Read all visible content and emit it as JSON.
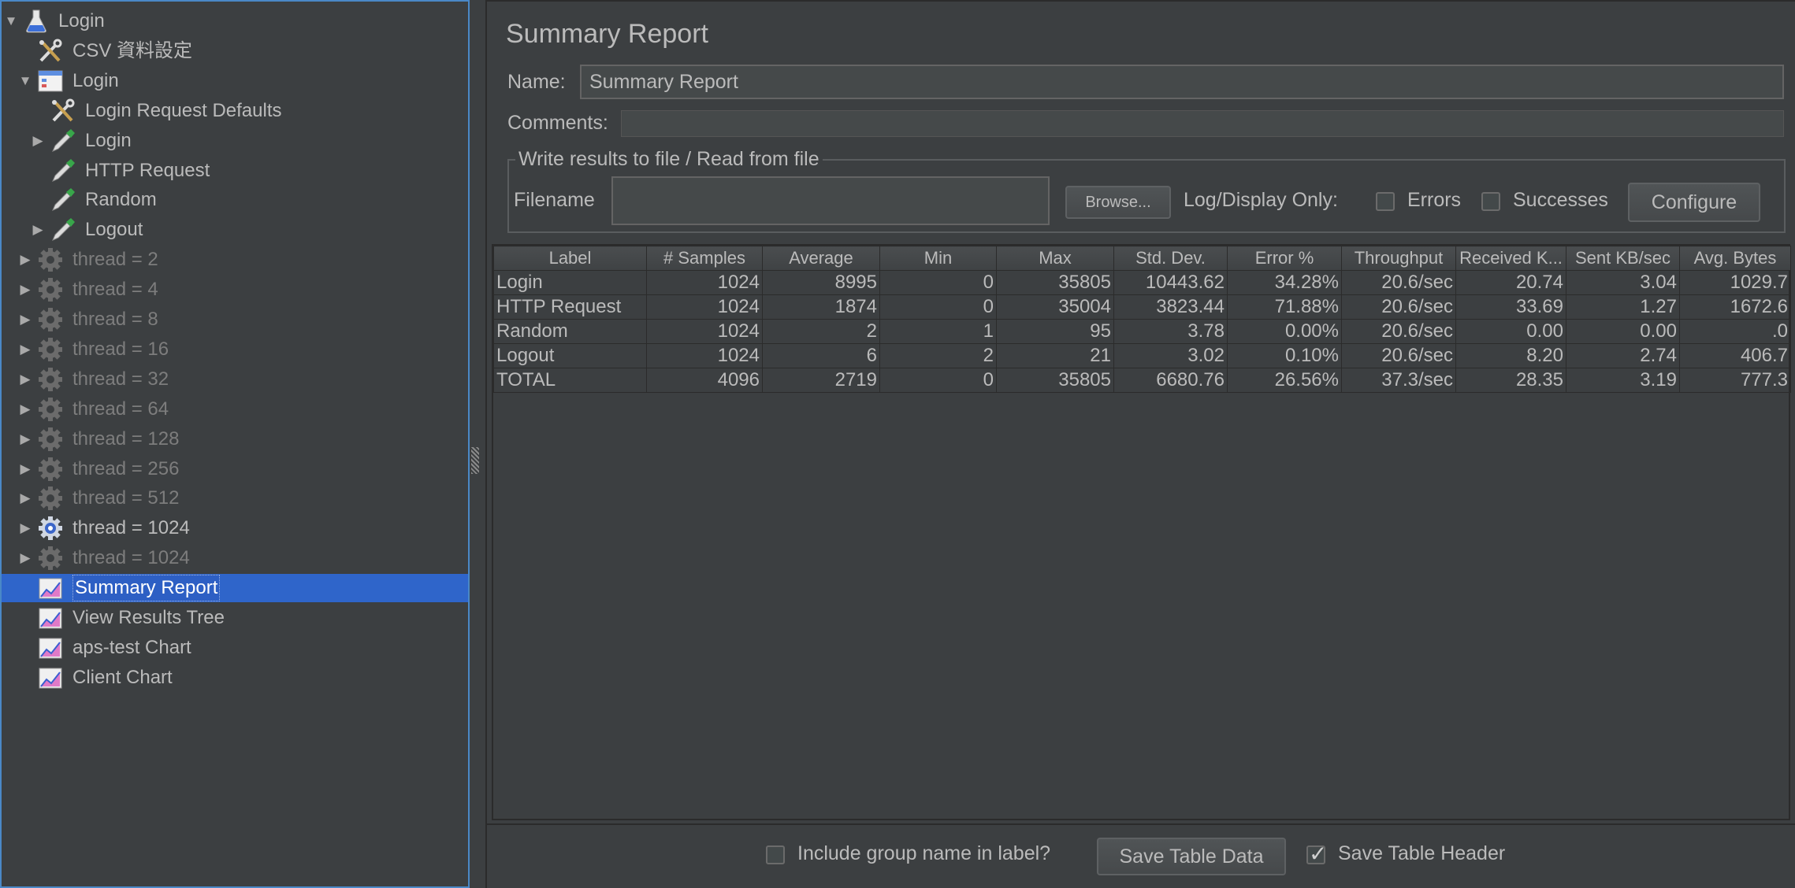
{
  "tree": [
    {
      "label": "Login",
      "icon": "flask-icon",
      "arrow": "▼",
      "level": 0,
      "state": "normal"
    },
    {
      "label": "CSV 資料設定",
      "icon": "config-tools-icon",
      "arrow": "",
      "level": 1,
      "state": "normal"
    },
    {
      "label": "Login",
      "icon": "thread-group-icon",
      "arrow": "▼",
      "level": 1,
      "state": "normal"
    },
    {
      "label": "Login Request Defaults",
      "icon": "config-tools-icon",
      "arrow": "",
      "level": 2,
      "state": "normal"
    },
    {
      "label": "Login",
      "icon": "sampler-pipette-icon",
      "arrow": "▶",
      "level": 2,
      "state": "normal"
    },
    {
      "label": "HTTP Request",
      "icon": "sampler-pipette-icon",
      "arrow": "",
      "level": 2,
      "state": "normal"
    },
    {
      "label": "Random",
      "icon": "sampler-pipette-icon",
      "arrow": "",
      "level": 2,
      "state": "normal"
    },
    {
      "label": "Logout",
      "icon": "sampler-pipette-icon",
      "arrow": "▶",
      "level": 2,
      "state": "normal"
    },
    {
      "label": "thread = 2",
      "icon": "gear-icon",
      "arrow": "▶",
      "level": 1,
      "state": "disabled"
    },
    {
      "label": "thread = 4",
      "icon": "gear-icon",
      "arrow": "▶",
      "level": 1,
      "state": "disabled"
    },
    {
      "label": "thread = 8",
      "icon": "gear-icon",
      "arrow": "▶",
      "level": 1,
      "state": "disabled"
    },
    {
      "label": "thread = 16",
      "icon": "gear-icon",
      "arrow": "▶",
      "level": 1,
      "state": "disabled"
    },
    {
      "label": "thread = 32",
      "icon": "gear-icon",
      "arrow": "▶",
      "level": 1,
      "state": "disabled"
    },
    {
      "label": "thread = 64",
      "icon": "gear-icon",
      "arrow": "▶",
      "level": 1,
      "state": "disabled"
    },
    {
      "label": "thread = 128",
      "icon": "gear-icon",
      "arrow": "▶",
      "level": 1,
      "state": "disabled"
    },
    {
      "label": "thread = 256",
      "icon": "gear-icon",
      "arrow": "▶",
      "level": 1,
      "state": "disabled"
    },
    {
      "label": "thread = 512",
      "icon": "gear-icon",
      "arrow": "▶",
      "level": 1,
      "state": "disabled"
    },
    {
      "label": "thread = 1024",
      "icon": "gear-active-icon",
      "arrow": "▶",
      "level": 1,
      "state": "normal"
    },
    {
      "label": "thread = 1024",
      "icon": "gear-icon",
      "arrow": "▶",
      "level": 1,
      "state": "disabled"
    },
    {
      "label": "Summary Report",
      "icon": "chart-listener-icon",
      "arrow": "",
      "level": 1,
      "state": "selected"
    },
    {
      "label": "View Results Tree",
      "icon": "chart-listener-icon",
      "arrow": "",
      "level": 1,
      "state": "normal"
    },
    {
      "label": "aps-test Chart",
      "icon": "chart-listener-icon",
      "arrow": "",
      "level": 1,
      "state": "normal"
    },
    {
      "label": "Client Chart",
      "icon": "chart-listener-icon",
      "arrow": "",
      "level": 1,
      "state": "normal"
    }
  ],
  "panel": {
    "title": "Summary Report",
    "name_label": "Name:",
    "name_value": "Summary Report",
    "comments_label": "Comments:",
    "file_group_legend": "Write results to file / Read from file",
    "filename_label": "Filename",
    "filename_value": "",
    "browse_label": "Browse...",
    "log_display_label": "Log/Display Only:",
    "errors_label": "Errors",
    "successes_label": "Successes",
    "configure_label": "Configure"
  },
  "table": {
    "headers": [
      "Label",
      "# Samples",
      "Average",
      "Min",
      "Max",
      "Std. Dev.",
      "Error %",
      "Throughput",
      "Received K...",
      "Sent KB/sec",
      "Avg. Bytes"
    ],
    "rows": [
      [
        "Login",
        "1024",
        "8995",
        "0",
        "35805",
        "10443.62",
        "34.28%",
        "20.6/sec",
        "20.74",
        "3.04",
        "1029.7"
      ],
      [
        "HTTP Request",
        "1024",
        "1874",
        "0",
        "35004",
        "3823.44",
        "71.88%",
        "20.6/sec",
        "33.69",
        "1.27",
        "1672.6"
      ],
      [
        "Random",
        "1024",
        "2",
        "1",
        "95",
        "3.78",
        "0.00%",
        "20.6/sec",
        "0.00",
        "0.00",
        ".0"
      ],
      [
        "Logout",
        "1024",
        "6",
        "2",
        "21",
        "3.02",
        "0.10%",
        "20.6/sec",
        "8.20",
        "2.74",
        "406.7"
      ],
      [
        "TOTAL",
        "4096",
        "2719",
        "0",
        "35805",
        "6680.76",
        "26.56%",
        "37.3/sec",
        "28.35",
        "3.19",
        "777.3"
      ]
    ]
  },
  "footer": {
    "include_group_label": "Include group name in label?",
    "include_group_checked": false,
    "save_table_data_label": "Save Table Data",
    "save_table_header_label": "Save Table Header",
    "save_table_header_checked": true
  }
}
